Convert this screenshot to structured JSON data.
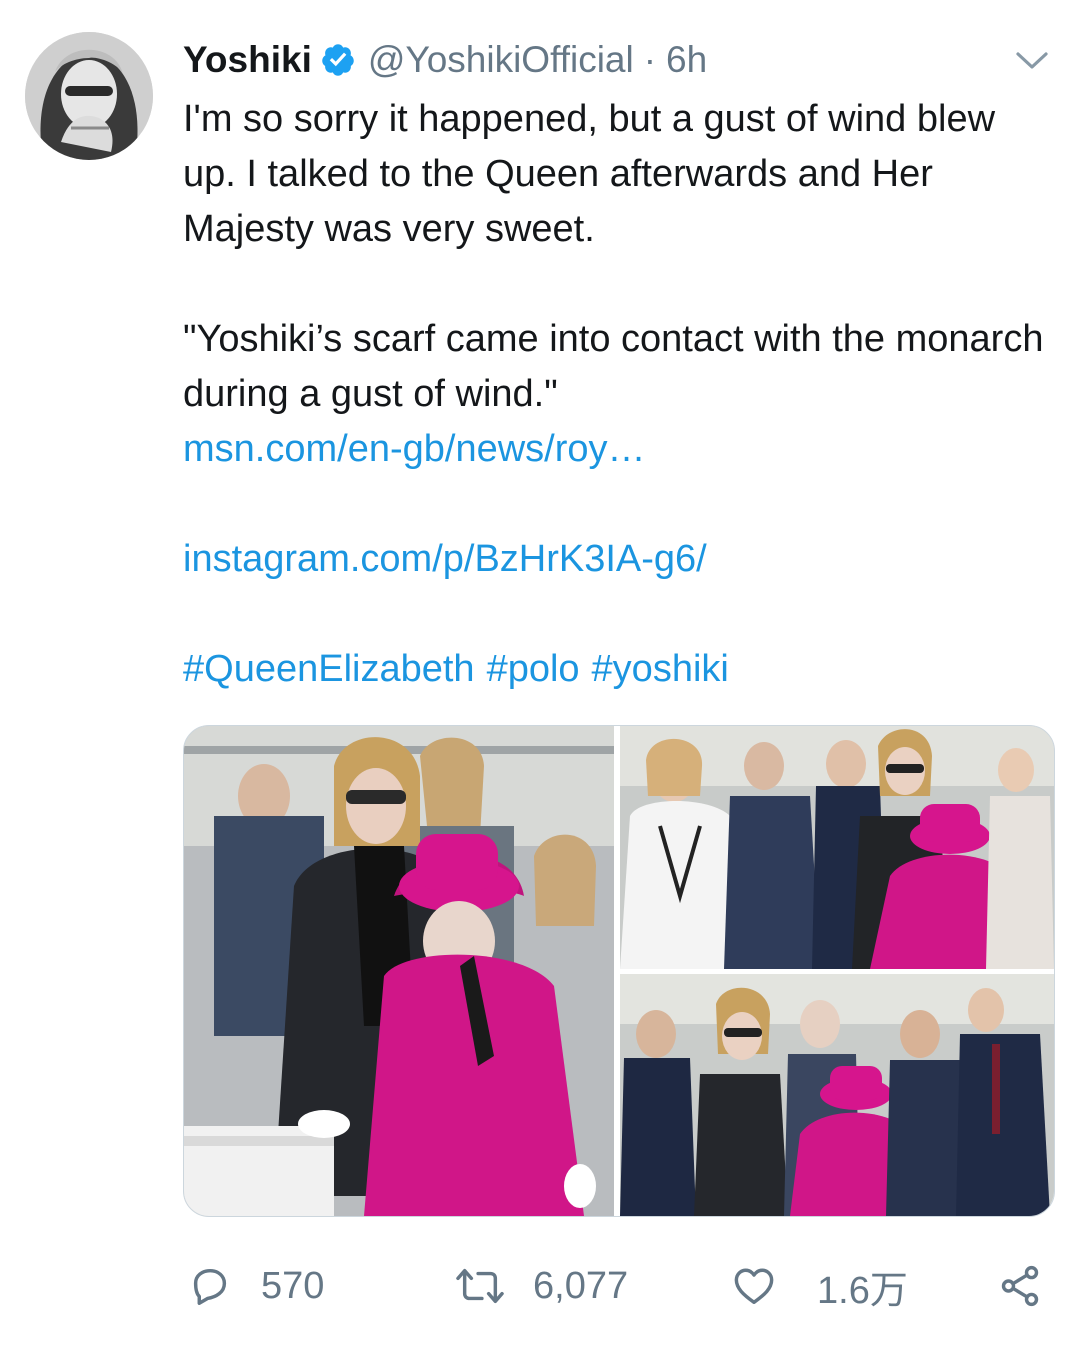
{
  "tweet": {
    "author": {
      "display_name": "Yoshiki",
      "handle": "@YoshikiOfficial",
      "verified": true,
      "avatar_icon": "user-avatar"
    },
    "separator": "·",
    "timestamp": "6h",
    "text_paragraph_1": "I'm so sorry it happened, but a gust of wind blew up. I talked to the Queen afterwards and Her Majesty was very sweet.",
    "text_paragraph_2": "\"Yoshiki’s scarf came into contact with the monarch during a gust of wind.\"",
    "link_1": "msn.com/en-gb/news/roy…",
    "link_2": "instagram.com/p/BzHrK3IA-g6/",
    "hashtags": [
      "#QueenElizabeth",
      "#polo",
      "#yoshiki"
    ],
    "media_count": 3
  },
  "actions": {
    "reply_count": "570",
    "retweet_count": "6,077",
    "like_count": "1.6万",
    "share_icon": "share-icon"
  },
  "colors": {
    "text": "#14171a",
    "secondary": "#657786",
    "link": "#1b95e0",
    "verified": "#1da1f2",
    "border": "#ccd6dd"
  }
}
